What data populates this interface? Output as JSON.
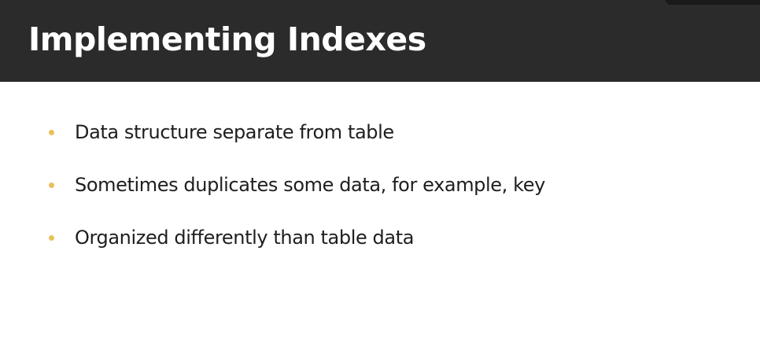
{
  "slide": {
    "title": "Implementing Indexes",
    "bullets": [
      {
        "text": "Data structure separate from table"
      },
      {
        "text": "Sometimes duplicates some data, for example, key"
      },
      {
        "text": "Organized differently than table data"
      }
    ]
  },
  "colors": {
    "title_bar_bg": "#2b2b2b",
    "title_text": "#ffffff",
    "bullet_dot": "#e8c15a",
    "body_text": "#1e1e1e",
    "slide_bg": "#ffffff"
  }
}
